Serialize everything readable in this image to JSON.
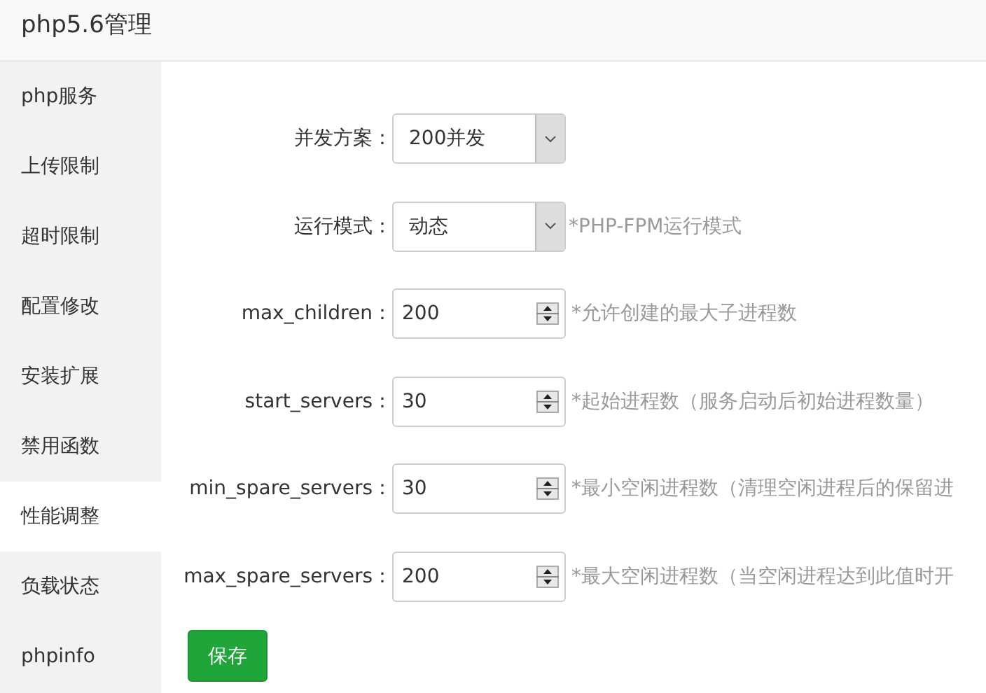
{
  "window": {
    "title": "php5.6管理"
  },
  "sidebar": {
    "items": [
      {
        "label": "php服务",
        "selected": false
      },
      {
        "label": "上传限制",
        "selected": false
      },
      {
        "label": "超时限制",
        "selected": false
      },
      {
        "label": "配置修改",
        "selected": false
      },
      {
        "label": "安装扩展",
        "selected": false
      },
      {
        "label": "禁用函数",
        "selected": false
      },
      {
        "label": "性能调整",
        "selected": true
      },
      {
        "label": "负载状态",
        "selected": false
      },
      {
        "label": "phpinfo",
        "selected": false
      }
    ]
  },
  "form": {
    "rows": [
      {
        "label": "并发方案：",
        "kind": "select",
        "value": "200并发"
      },
      {
        "label": "运行模式：",
        "kind": "select",
        "value": "动态",
        "hint": "*PHP-FPM运行模式"
      },
      {
        "label": "max_children：",
        "kind": "number",
        "value": "200",
        "hint": "*允许创建的最大子进程数"
      },
      {
        "label": "start_servers：",
        "kind": "number",
        "value": "30",
        "hint": "*起始进程数（服务启动后初始进程数量）"
      },
      {
        "label": "min_spare_servers：",
        "kind": "number",
        "value": "30",
        "hint": "*最小空闲进程数（清理空闲进程后的保留进"
      },
      {
        "label": "max_spare_servers：",
        "kind": "number",
        "value": "200",
        "hint": "*最大空闲进程数（当空闲进程达到此值时开"
      }
    ],
    "save_button": "保存"
  }
}
